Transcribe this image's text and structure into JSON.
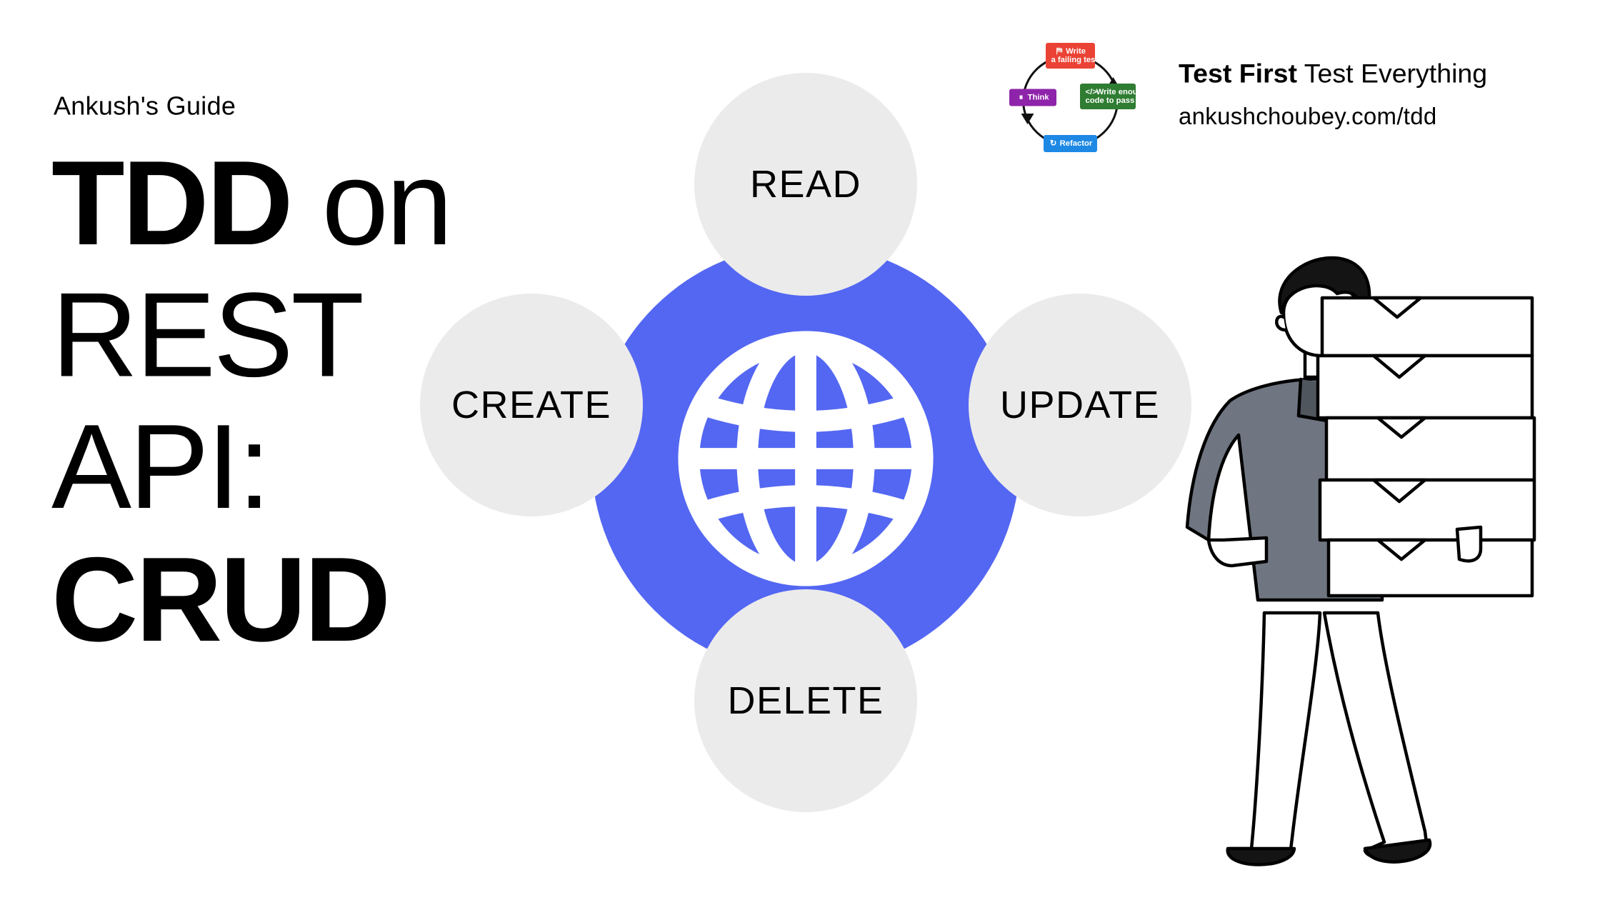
{
  "kicker": "Ankush's Guide",
  "title": {
    "l1a": "TDD",
    "l1b": " on",
    "l2": "REST",
    "l3": "API:",
    "l4": "CRUD"
  },
  "toptext": {
    "bold": "Test First",
    "rest": " Test Everything",
    "url": "ankushchoubey.com/tdd"
  },
  "badge": {
    "top": "Write\na failing test",
    "left": "Think",
    "right": "Write enough\ncode to pass the test",
    "bottom": "Refactor",
    "top_icon": "⛿",
    "left_icon": "⏸",
    "right_icon": "</>",
    "bottom_icon": "↻"
  },
  "crud": {
    "read": "READ",
    "create": "CREATE",
    "update": "UPDATE",
    "delete": "DELETE"
  },
  "colors": {
    "core": "#5467f2",
    "bubble": "#ecebeb",
    "badge_top": "#ea4335",
    "badge_left": "#8e24aa",
    "badge_right": "#2e7d32",
    "badge_bottom": "#1e88e5"
  }
}
